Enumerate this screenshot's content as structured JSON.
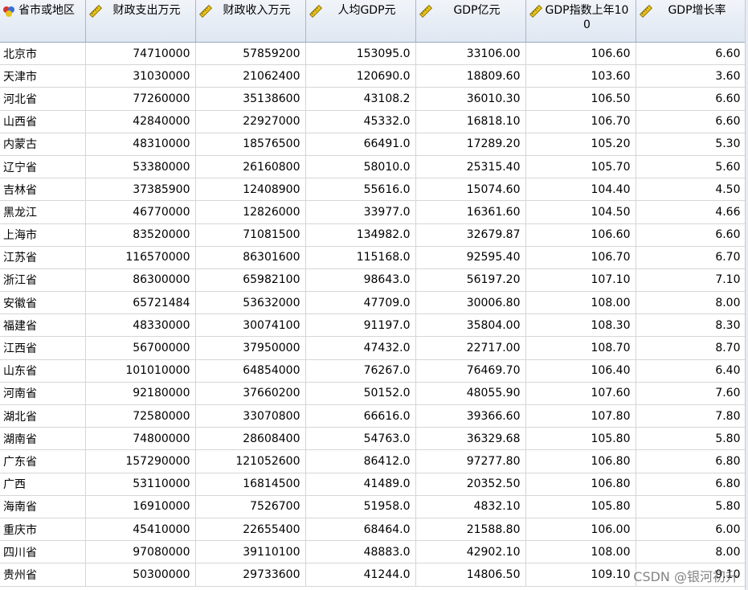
{
  "columns": [
    {
      "label": "省市或地区",
      "icon": "nominal-icon"
    },
    {
      "label": "财政支出万元",
      "icon": "ruler-icon"
    },
    {
      "label": "财政收入万元",
      "icon": "ruler-icon"
    },
    {
      "label": "人均GDP元",
      "icon": "ruler-icon"
    },
    {
      "label": "GDP亿元",
      "icon": "ruler-icon"
    },
    {
      "label": "GDP指数上年100",
      "icon": "ruler-icon"
    },
    {
      "label": "GDP增长率",
      "icon": "ruler-icon"
    }
  ],
  "rows": [
    [
      "北京市",
      "74710000",
      "57859200",
      "153095.0",
      "33106.00",
      "106.60",
      "6.60"
    ],
    [
      "天津市",
      "31030000",
      "21062400",
      "120690.0",
      "18809.60",
      "103.60",
      "3.60"
    ],
    [
      "河北省",
      "77260000",
      "35138600",
      "43108.2",
      "36010.30",
      "106.50",
      "6.60"
    ],
    [
      "山西省",
      "42840000",
      "22927000",
      "45332.0",
      "16818.10",
      "106.70",
      "6.60"
    ],
    [
      "内蒙古",
      "48310000",
      "18576500",
      "66491.0",
      "17289.20",
      "105.20",
      "5.30"
    ],
    [
      "辽宁省",
      "53380000",
      "26160800",
      "58010.0",
      "25315.40",
      "105.70",
      "5.60"
    ],
    [
      "吉林省",
      "37385900",
      "12408900",
      "55616.0",
      "15074.60",
      "104.40",
      "4.50"
    ],
    [
      "黑龙江",
      "46770000",
      "12826000",
      "33977.0",
      "16361.60",
      "104.50",
      "4.66"
    ],
    [
      "上海市",
      "83520000",
      "71081500",
      "134982.0",
      "32679.87",
      "106.60",
      "6.60"
    ],
    [
      "江苏省",
      "116570000",
      "86301600",
      "115168.0",
      "92595.40",
      "106.70",
      "6.70"
    ],
    [
      "浙江省",
      "86300000",
      "65982100",
      "98643.0",
      "56197.20",
      "107.10",
      "7.10"
    ],
    [
      "安徽省",
      "65721484",
      "53632000",
      "47709.0",
      "30006.80",
      "108.00",
      "8.00"
    ],
    [
      "福建省",
      "48330000",
      "30074100",
      "91197.0",
      "35804.00",
      "108.30",
      "8.30"
    ],
    [
      "江西省",
      "56700000",
      "37950000",
      "47432.0",
      "22717.00",
      "108.70",
      "8.70"
    ],
    [
      "山东省",
      "101010000",
      "64854000",
      "76267.0",
      "76469.70",
      "106.40",
      "6.40"
    ],
    [
      "河南省",
      "92180000",
      "37660200",
      "50152.0",
      "48055.90",
      "107.60",
      "7.60"
    ],
    [
      "湖北省",
      "72580000",
      "33070800",
      "66616.0",
      "39366.60",
      "107.80",
      "7.80"
    ],
    [
      "湖南省",
      "74800000",
      "28608400",
      "54763.0",
      "36329.68",
      "105.80",
      "5.80"
    ],
    [
      "广东省",
      "157290000",
      "121052600",
      "86412.0",
      "97277.80",
      "106.80",
      "6.80"
    ],
    [
      "广西",
      "53110000",
      "16814500",
      "41489.0",
      "20352.50",
      "106.80",
      "6.80"
    ],
    [
      "海南省",
      "16910000",
      "7526700",
      "51958.0",
      "4832.10",
      "105.80",
      "5.80"
    ],
    [
      "重庆市",
      "45410000",
      "22655400",
      "68464.0",
      "21588.80",
      "106.00",
      "6.00"
    ],
    [
      "四川省",
      "97080000",
      "39110100",
      "48883.0",
      "42902.10",
      "108.00",
      "8.00"
    ],
    [
      "贵州省",
      "50300000",
      "29733600",
      "41244.0",
      "14806.50",
      "109.10",
      "9.10"
    ]
  ],
  "watermark": "CSDN @银河初升",
  "colors": {
    "header_bg": "#dfe7f2",
    "grid_line": "#d6d6d6",
    "ruler_yellow": "#e8c21a"
  }
}
